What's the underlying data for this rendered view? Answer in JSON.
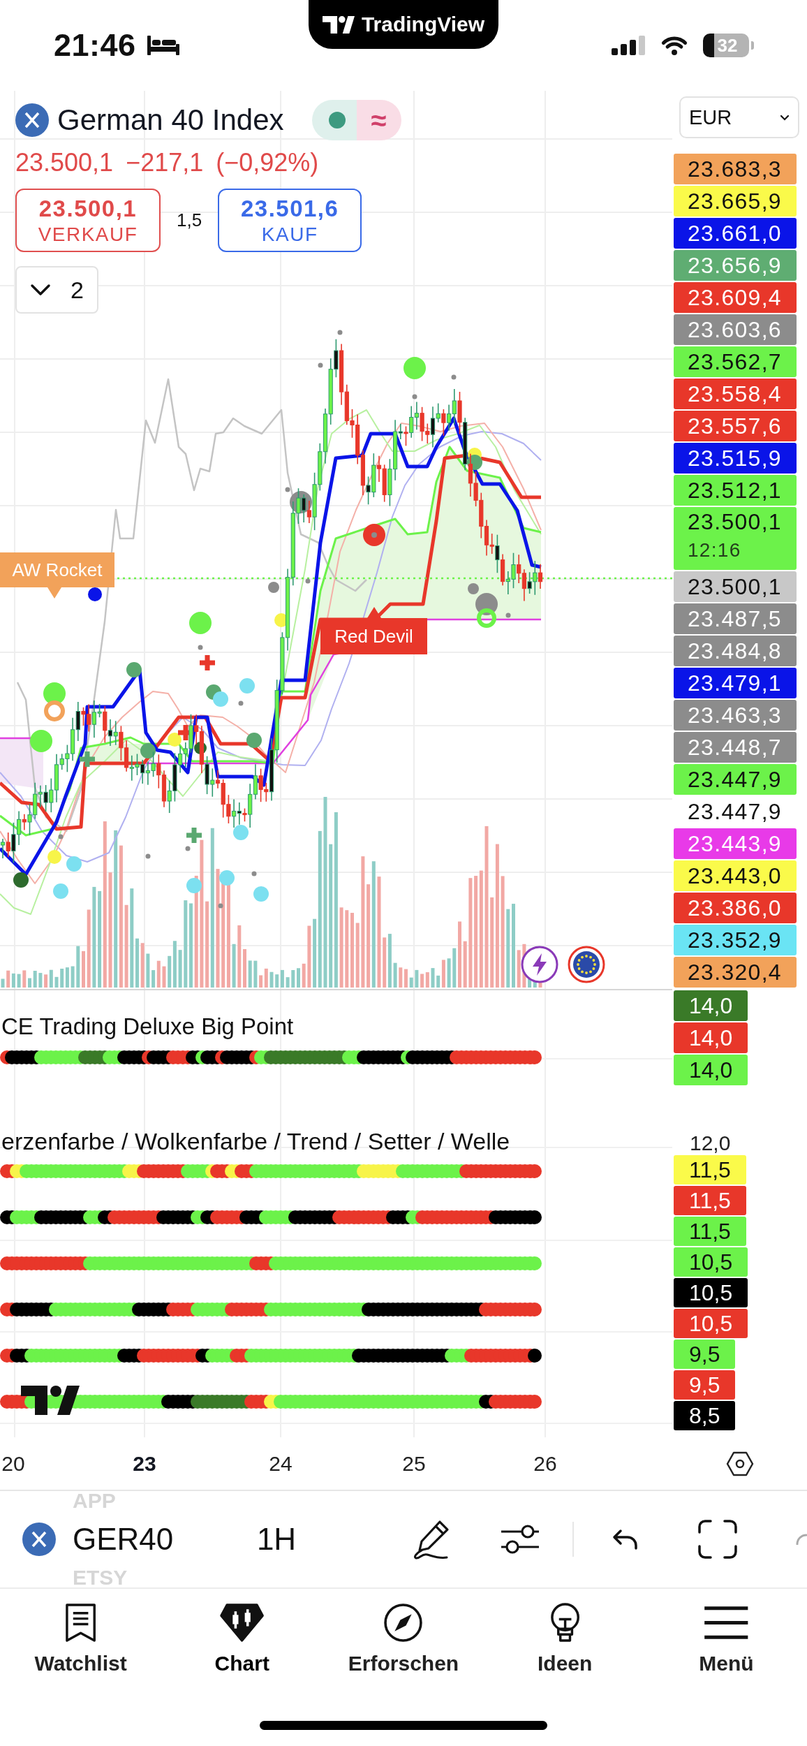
{
  "status_bar": {
    "time": "21:46",
    "app_name": "TradingView",
    "battery": "32"
  },
  "header": {
    "title": "German 40 Index",
    "status_symbol": "≈",
    "price_change": "23.500,1 −217,1 (−0,92%)",
    "sell": {
      "price": "23.500,1",
      "label": "VERKAUF"
    },
    "spread": "1,5",
    "buy": {
      "price": "23.501,6",
      "label": "KAUF"
    },
    "collapse_count": "2"
  },
  "price_scale": {
    "currency": "EUR",
    "tags": [
      {
        "price": "23.683,3",
        "color": "#f2a25a"
      },
      {
        "price": "23.665,9",
        "color": "#fafa4a"
      },
      {
        "price": "23.661,0",
        "color": "#0a14e8"
      },
      {
        "price": "23.656,9",
        "color": "#5fad72"
      },
      {
        "price": "23.609,4",
        "color": "#e8372a"
      },
      {
        "price": "23.603,6",
        "color": "#8c8c8c"
      },
      {
        "price": "23.562,7",
        "color": "#6cf24a"
      },
      {
        "price": "23.558,4",
        "color": "#e8372a"
      },
      {
        "price": "23.557,6",
        "color": "#e8372a"
      },
      {
        "price": "23.515,9",
        "color": "#0a14e8"
      },
      {
        "price": "23.512,1",
        "color": "#6cf24a"
      },
      {
        "price": "23.500,1",
        "countdown": "12:16",
        "color": "#6cf24a"
      },
      {
        "price": "23.500,1",
        "color": "#c8c8c8"
      },
      {
        "price": "23.487,5",
        "color": "#8c8c8c"
      },
      {
        "price": "23.484,8",
        "color": "#8c8c8c"
      },
      {
        "price": "23.479,1",
        "color": "#0a14e8"
      },
      {
        "price": "23.463,3",
        "color": "#8c8c8c"
      },
      {
        "price": "23.448,7",
        "color": "#8c8c8c"
      },
      {
        "price": "23.447,9",
        "color": "#6cf24a"
      },
      {
        "price": "23.447,9",
        "color": "#ffffff"
      },
      {
        "price": "23.443,9",
        "color": "#e83ae8"
      },
      {
        "price": "23.443,0",
        "color": "#fafa4a"
      },
      {
        "price": "23.386,0",
        "color": "#e8372a"
      },
      {
        "price": "23.352,9",
        "color": "#6ae4f4"
      },
      {
        "price": "23.320,4",
        "color": "#f2a25a"
      }
    ]
  },
  "chart_labels": [
    {
      "text": "AW Rocket",
      "color": "#f2a25a"
    },
    {
      "text": "Red Devil",
      "color": "#e8372a"
    }
  ],
  "panes": [
    {
      "title": "CE Trading Deluxe Big Point",
      "tags": [
        {
          "value": "14,0",
          "color": "#3a7a28"
        },
        {
          "value": "14,0",
          "color": "#e8372a"
        },
        {
          "value": "14,0",
          "color": "#6cf24a"
        }
      ]
    },
    {
      "title": "erzenfarbe / Wolkenfarbe / Trend / Setter / Welle",
      "scale_label": "12,0",
      "tags": [
        {
          "value": "11,5",
          "color": "#fafa4a"
        },
        {
          "value": "11,5",
          "color": "#e8372a"
        },
        {
          "value": "11,5",
          "color": "#6cf24a"
        },
        {
          "value": "10,5",
          "color": "#6cf24a"
        },
        {
          "value": "10,5",
          "color": "#000000"
        },
        {
          "value": "10,5",
          "color": "#e8372a"
        },
        {
          "value": "9,5",
          "color": "#6cf24a"
        },
        {
          "value": "9,5",
          "color": "#e8372a"
        },
        {
          "value": "8,5",
          "color": "#000000"
        }
      ]
    }
  ],
  "time_axis": [
    {
      "label": "20",
      "major": false
    },
    {
      "label": "23",
      "major": true
    },
    {
      "label": "24",
      "major": false
    },
    {
      "label": "25",
      "major": false
    },
    {
      "label": "26",
      "major": false
    }
  ],
  "toolbar": {
    "symbol": "GER40",
    "interval": "1H",
    "picker_above": "APP",
    "picker_below": "ETSY"
  },
  "tab_bar": [
    {
      "label": "Watchlist",
      "kind": "watchlist",
      "selected": false
    },
    {
      "label": "Chart",
      "kind": "chart",
      "selected": true
    },
    {
      "label": "Erforschen",
      "kind": "explore",
      "selected": false
    },
    {
      "label": "Ideen",
      "kind": "ideas",
      "selected": false
    },
    {
      "label": "Menü",
      "kind": "menu",
      "selected": false
    }
  ]
}
